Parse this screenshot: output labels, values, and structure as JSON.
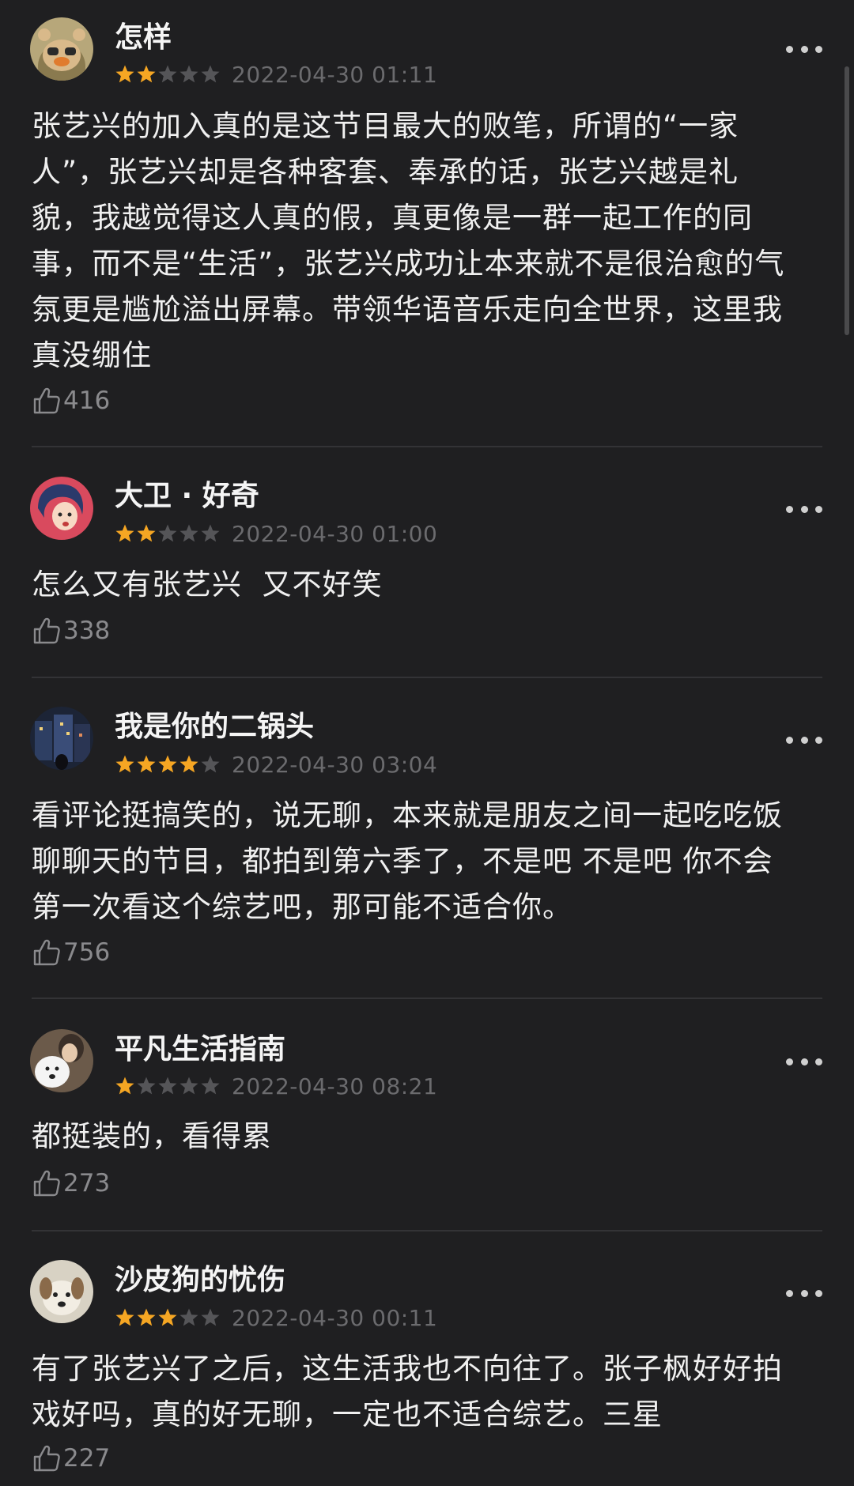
{
  "comments": [
    {
      "username": "怎样",
      "rating": 2,
      "timestamp": "2022-04-30 01:11",
      "text": "张艺兴的加入真的是这节目最大的败笔，所谓的“一家\n人”，张艺兴却是各种客套、奉承的话，张艺兴越是礼\n貌，我越觉得这人真的假，真更像是一群一起工作的同\n事，而不是“生活”，张艺兴成功让本来就不是很治愈的气\n氛更是尴尬溢出屏幕。带领华语音乐走向全世界，这里我\n真没绷住",
      "likes": "416",
      "avatar_icon": "cartoon-bear-avatar-icon"
    },
    {
      "username": "大卫 · 好奇",
      "rating": 2,
      "timestamp": "2022-04-30 01:00",
      "text": "怎么又有张艺兴  又不好笑",
      "likes": "338",
      "avatar_icon": "anime-girl-avatar-icon"
    },
    {
      "username": "我是你的二锅头",
      "rating": 4,
      "timestamp": "2022-04-30 03:04",
      "text": "看评论挺搞笑的，说无聊，本来就是朋友之间一起吃吃饭\n聊聊天的节目，都拍到第六季了，不是吧 不是吧 你不会\n第一次看这个综艺吧，那可能不适合你。",
      "likes": "756",
      "avatar_icon": "night-street-avatar-icon"
    },
    {
      "username": "平凡生活指南",
      "rating": 1,
      "timestamp": "2022-04-30 08:21",
      "text": "都挺装的，看得累",
      "likes": "273",
      "avatar_icon": "dog-photo-avatar-icon"
    },
    {
      "username": "沙皮狗的忧伤",
      "rating": 3,
      "timestamp": "2022-04-30 00:11",
      "text": "有了张艺兴了之后，这生活我也不向往了。张子枫好好拍\n戏好吗，真的好无聊，一定也不适合综艺。三星",
      "likes": "227",
      "avatar_icon": "puppy-avatar-icon"
    }
  ],
  "colors": {
    "background": "#1f1f21",
    "star_filled": "#f5a623",
    "star_empty": "#555558",
    "timestamp": "#6b6b6e",
    "text": "#f0f0f0"
  }
}
